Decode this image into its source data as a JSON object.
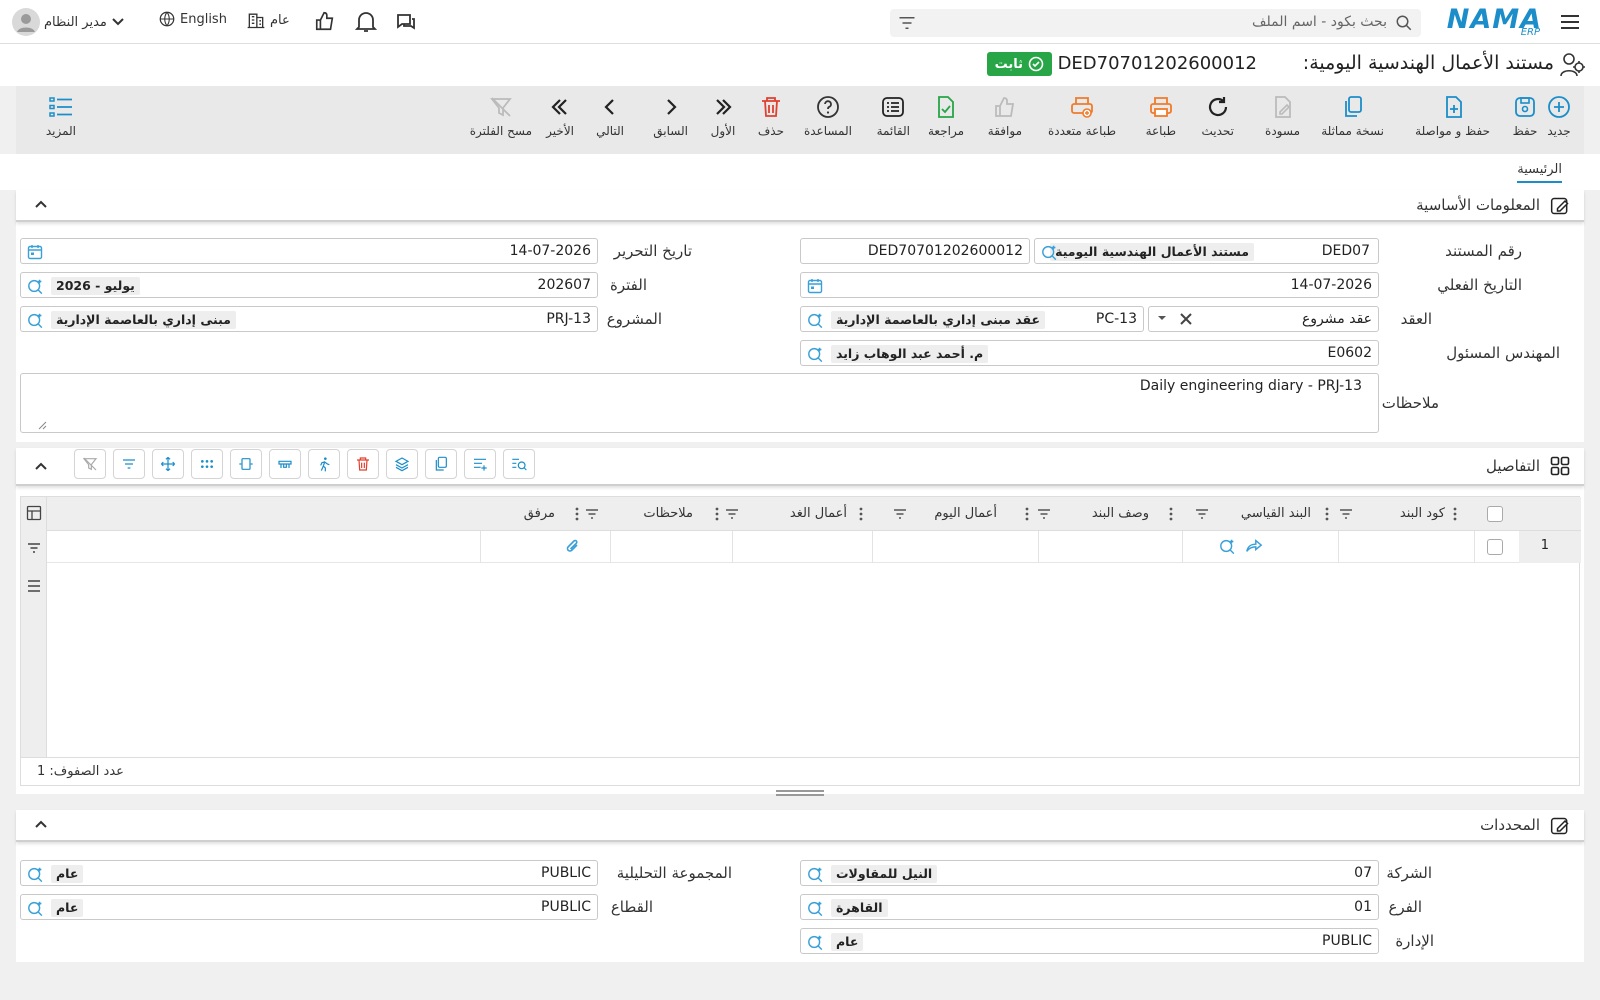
{
  "header": {
    "search_placeholder": "بحث بكود - اسم الملف",
    "logo_text": "NAMA",
    "logo_sub": "ERP",
    "branch": "عام",
    "language": "English",
    "user": "مدير النظام"
  },
  "title": {
    "text": "مستند الأعمال الهندسية اليومية:",
    "doc_no": "DED70701202600012",
    "status": "ثابت"
  },
  "toolbar": [
    {
      "label": "جديد",
      "icon": "plus-circle-icon"
    },
    {
      "label": "حفظ",
      "icon": "save-icon"
    },
    {
      "label": "حفظ و مواصلة",
      "icon": "save-add-icon"
    },
    {
      "label": "نسخة مماثلة",
      "icon": "copy-icon"
    },
    {
      "label": "مسودة",
      "icon": "draft-icon"
    },
    {
      "label": "تحديث",
      "icon": "refresh-icon"
    },
    {
      "label": "طباعة",
      "icon": "print-icon"
    },
    {
      "label": "طباعة متعددة",
      "icon": "multi-print-icon"
    },
    {
      "label": "موافقة",
      "icon": "thumbs-up-icon"
    },
    {
      "label": "مراجعة",
      "icon": "review-icon"
    },
    {
      "label": "القائمة",
      "icon": "list-icon"
    },
    {
      "label": "المساعدة",
      "icon": "help-icon"
    },
    {
      "label": "حذف",
      "icon": "trash-icon"
    },
    {
      "label": "الأول",
      "icon": "first-icon"
    },
    {
      "label": "السابق",
      "icon": "prev-icon"
    },
    {
      "label": "التالي",
      "icon": "next-icon"
    },
    {
      "label": "الأخير",
      "icon": "last-icon"
    },
    {
      "label": "مسح الفلترة",
      "icon": "clear-filter-icon"
    },
    {
      "label": "المزيد",
      "icon": "more-icon"
    }
  ],
  "tabs": {
    "main": "الرئيسية"
  },
  "basic": {
    "title": "المعلومات الأساسية",
    "doc_number_label": "رقم المستند",
    "doc_type_code": "DED07",
    "doc_type_name": "مستند الأعمال الهندسية اليومية",
    "doc_number": "DED70701202600012",
    "edit_date_label": "تاريخ التحرير",
    "edit_date": "14-07-2026",
    "actual_date_label": "التاريخ الفعلي",
    "actual_date": "14-07-2026",
    "period_label": "الفترة",
    "period_code": "202607",
    "period_name": "2026 - يوليو",
    "contract_label": "العقد",
    "contract_type": "عقد مشروع",
    "contract_code": "PC-13",
    "contract_name": "عقد مبنى إداري بالعاصمة الإدارية",
    "project_label": "المشروع",
    "project_code": "PRJ-13",
    "project_name": "مبنى إداري بالعاصمة الإدارية",
    "engineer_label": "المهندس المسئول",
    "engineer_code": "E0602",
    "engineer_name": "م. أحمد عبد الوهاب زايد",
    "notes_label": "ملاحظات",
    "notes": "Daily engineering diary - PRJ-13"
  },
  "details": {
    "title": "التفاصيل",
    "columns": [
      "كود البند",
      "البند القياسي",
      "وصف البند",
      "أعمال اليوم",
      "أعمال الغد",
      "ملاحظات",
      "مرفق"
    ],
    "row_number": "1",
    "row_count": "عدد الصفوف: 1"
  },
  "dims": {
    "title": "المحددات",
    "company_label": "الشركة",
    "company_code": "07",
    "company_name": "النيل للمقاولات",
    "branch_label": "الفرع",
    "branch_code": "01",
    "branch_name": "القاهرة",
    "dept_label": "الإدارة",
    "dept_code": "PUBLIC",
    "dept_name": "عام",
    "analytic_label": "المجموعة التحليلية",
    "analytic_code": "PUBLIC",
    "analytic_name": "عام",
    "sector_label": "القطاع",
    "sector_code": "PUBLIC",
    "sector_name": "عام"
  },
  "colors": {
    "accent": "#1b8ec9",
    "status": "#27a547",
    "danger": "#e0402f",
    "print": "#f07b2a",
    "green": "#27a547"
  }
}
